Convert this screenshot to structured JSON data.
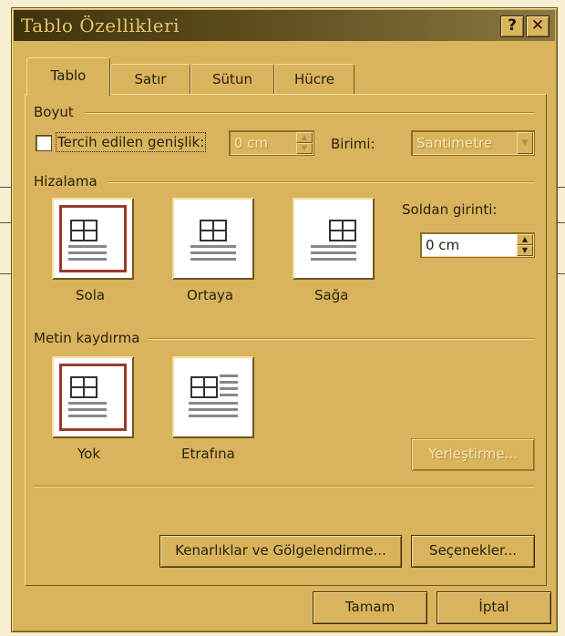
{
  "window": {
    "title": "Tablo Özellikleri",
    "help_label": "?",
    "close_label": "✕"
  },
  "tabs": [
    {
      "label": "Tablo",
      "active": true
    },
    {
      "label": "Satır",
      "active": false
    },
    {
      "label": "Sütun",
      "active": false
    },
    {
      "label": "Hücre",
      "active": false
    }
  ],
  "size": {
    "group_label": "Boyut",
    "preferred_width_label": "Tercih edilen genişlik:",
    "preferred_width_value": "0 cm",
    "unit_label": "Birimi:",
    "unit_value": "Santimetre"
  },
  "alignment": {
    "group_label": "Hizalama",
    "options": [
      "Sola",
      "Ortaya",
      "Sağa"
    ],
    "selected": "Sola",
    "indent_label": "Soldan girinti:",
    "indent_value": "0 cm"
  },
  "wrapping": {
    "group_label": "Metin kaydırma",
    "options": [
      "Yok",
      "Etrafına"
    ],
    "selected": "Yok",
    "positioning_button": "Yerleştirme..."
  },
  "buttons": {
    "borders": "Kenarlıklar ve Gölgelendirme...",
    "options": "Seçenekler...",
    "ok": "Tamam",
    "cancel": "İptal"
  },
  "colors": {
    "dialog_bg": "#d9b45c",
    "selection_ring": "#9a3a2a",
    "title_text": "#e9c56a"
  },
  "icons": {
    "help": "question-mark-icon",
    "close": "close-x-icon",
    "spin_up": "up-arrow-icon",
    "spin_down": "down-arrow-icon",
    "dropdown": "down-arrow-icon"
  }
}
